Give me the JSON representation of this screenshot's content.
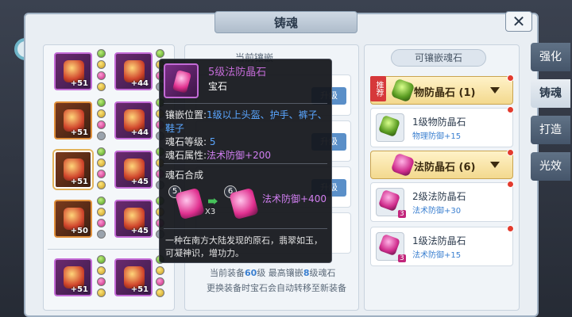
{
  "window": {
    "title": "铸魂",
    "close_glyph": "✕"
  },
  "tabs": [
    {
      "label": "强化"
    },
    {
      "label": "铸魂"
    },
    {
      "label": "打造"
    },
    {
      "label": "光效"
    }
  ],
  "equipment": [
    {
      "level": "+51"
    },
    {
      "level": "+44"
    },
    {
      "level": "+51"
    },
    {
      "level": "+44"
    },
    {
      "level": "+51"
    },
    {
      "level": "+45"
    },
    {
      "level": "+50"
    },
    {
      "level": "+45"
    },
    {
      "level": "+51"
    },
    {
      "level": "+51"
    }
  ],
  "center": {
    "header": "当前镶嵌",
    "upgrade_label": "升级",
    "footer_line1_prefix": "当前装备",
    "footer_line1_num1": "60",
    "footer_line1_mid": "级 最高镶嵌",
    "footer_line1_num2": "8",
    "footer_line1_suffix": "级魂石",
    "footer_line2": "更换装备时宝石会自动转移至新装备"
  },
  "right": {
    "header": "可镶嵌魂石",
    "recommend_tag": "推荐",
    "categories": [
      {
        "label": "物防晶石 (1)"
      },
      {
        "label": "法防晶石 (6)"
      }
    ],
    "items": [
      {
        "name": "1级物防晶石",
        "attr": "物理防御+15",
        "count": ""
      },
      {
        "name": "2级法防晶石",
        "attr": "法术防御+30",
        "count": "3"
      },
      {
        "name": "1级法防晶石",
        "attr": "法术防御+15",
        "count": "3"
      }
    ]
  },
  "tooltip": {
    "name": "5级法防晶石",
    "type": "宝石",
    "slot_label": "镶嵌位置:",
    "slot_value": "1级以上头盔、护手、裤子、鞋子",
    "level_label": "魂石等级:",
    "level_value": "5",
    "attr_label": "魂石属性:",
    "attr_value": "法术防御+200",
    "merge_label": "魂石合成",
    "from_level": "5",
    "to_level": "6",
    "multiplier": "X3",
    "merge_result": "法术防御+400",
    "description": "一种在南方大陆发现的原石，翡翠如玉，可凝神识，增功力。"
  }
}
